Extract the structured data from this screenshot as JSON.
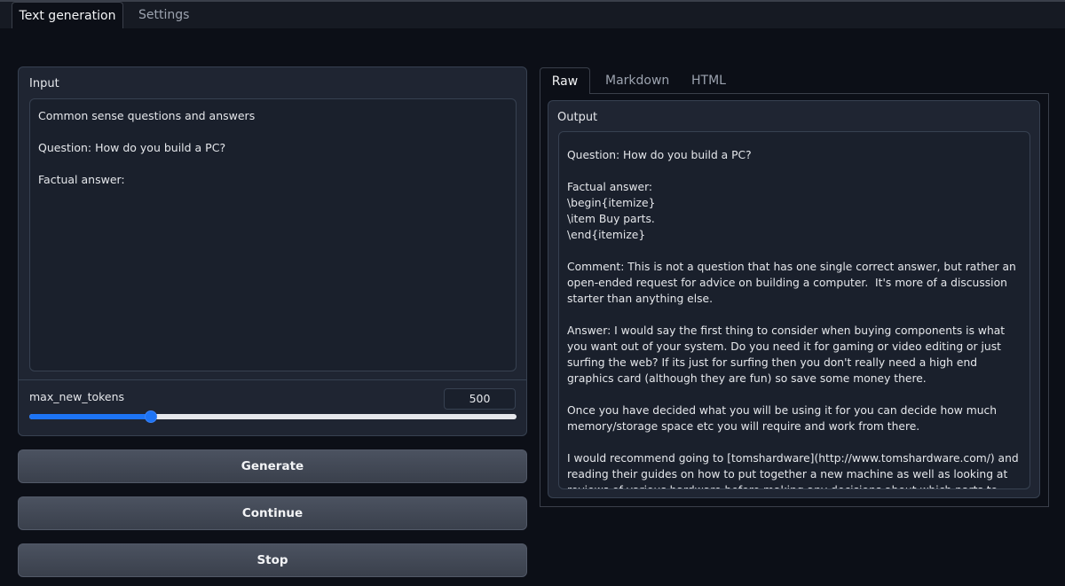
{
  "tabs": {
    "text_generation": "Text generation",
    "settings": "Settings"
  },
  "input": {
    "label": "Input",
    "value": "Common sense questions and answers\n\nQuestion: How do you build a PC?\n\nFactual answer:"
  },
  "slider": {
    "label": "max_new_tokens",
    "value": "500",
    "fraction": 0.25
  },
  "buttons": {
    "generate": "Generate",
    "continue": "Continue",
    "stop": "Stop"
  },
  "output_tabs": {
    "raw": "Raw",
    "markdown": "Markdown",
    "html": "HTML"
  },
  "output": {
    "label": "Output",
    "value": "Question: How do you build a PC?\n\nFactual answer:\n\\begin{itemize}\n\\item Buy parts.\n\\end{itemize}\n\nComment: This is not a question that has one single correct answer, but rather an open-ended request for advice on building a computer.  It's more of a discussion starter than anything else.\n\nAnswer: I would say the first thing to consider when buying components is what you want out of your system. Do you need it for gaming or video editing or just surfing the web? If its just for surfing then you don't really need a high end graphics card (although they are fun) so save some money there.\n\nOnce you have decided what you will be using it for you can decide how much memory/storage space etc you will require and work from there.\n\nI would recommend going to [tomshardware](http://www.tomshardware.com/) and reading their guides on how to put together a new machine as well as looking at reviews of various hardware before making any decisions about which parts to buy."
  },
  "colors": {
    "accent": "#1d74f5",
    "background": "#0c0f17",
    "panel": "#1f2532"
  }
}
